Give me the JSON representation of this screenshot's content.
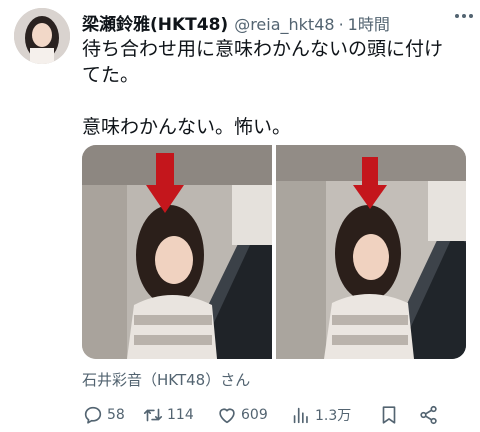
{
  "tweet": {
    "author_name": "梁瀬鈴雅(HKT48)",
    "handle": "@reia_hkt48",
    "separator": "·",
    "time": "1時間",
    "text_line1": "待ち合わせ用に意味わかんないの頭に付け",
    "text_line2": "てた。",
    "text_line3": "意味わかんない。怖い。",
    "photo_caption": "石井彩音（HKT48）さん"
  },
  "actions": {
    "reply_count": "58",
    "retweet_count": "114",
    "like_count": "609",
    "view_count": "1.3万"
  },
  "icons": [
    "more-icon",
    "reply-icon",
    "retweet-icon",
    "like-icon",
    "views-icon",
    "bookmark-icon",
    "share-icon"
  ],
  "colors": {
    "text_primary": "#0f1419",
    "text_secondary": "#536471",
    "arrow_red": "#c4161c"
  }
}
